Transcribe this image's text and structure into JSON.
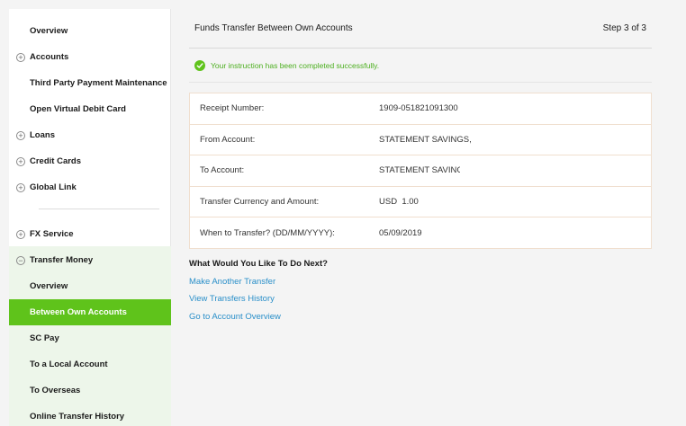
{
  "sidebar": {
    "items": [
      {
        "label": "Overview",
        "expandable": false
      },
      {
        "label": "Accounts",
        "expandable": true
      },
      {
        "label": "Third Party Payment Maintenance",
        "expandable": false
      },
      {
        "label": "Open Virtual Debit Card",
        "expandable": false
      },
      {
        "label": "Loans",
        "expandable": true
      },
      {
        "label": "Credit Cards",
        "expandable": true
      },
      {
        "label": "Global Link",
        "expandable": true
      },
      {
        "label": "FX Service",
        "expandable": true
      },
      {
        "label": "Transfer Money",
        "expandable": true,
        "expanded": true
      },
      {
        "label": "Overview",
        "sub": true
      },
      {
        "label": "Between Own Accounts",
        "sub": true,
        "active": true
      },
      {
        "label": "SC Pay",
        "sub": true
      },
      {
        "label": "To a Local Account",
        "sub": true
      },
      {
        "label": "To Overseas",
        "sub": true
      },
      {
        "label": "Online Transfer History",
        "sub": true
      }
    ],
    "expand_glyph": "+",
    "collapse_glyph": "−"
  },
  "main": {
    "title": "Funds Transfer Between Own Accounts",
    "step": "Step 3 of 3",
    "success_message": "Your instruction has been completed successfully.",
    "details": [
      {
        "label": "Receipt Number:",
        "value": "1909-051821091300"
      },
      {
        "label": "From Account:",
        "value": "STATEMENT SAVINGS,"
      },
      {
        "label": "To Account:",
        "value": "STATEMENT SAVINGS,"
      },
      {
        "label": "Transfer Currency and Amount:",
        "value": "USD  1.00"
      },
      {
        "label": "When to Transfer? (DD/MM/YYYY):",
        "value": "05/09/2019"
      }
    ],
    "next_title": "What Would You Like To Do Next?",
    "links": [
      "Make Another Transfer",
      "View Transfers History",
      "Go to Account Overview"
    ]
  },
  "colors": {
    "accent_green": "#5fc31b",
    "success_text": "#4caf1f",
    "link_blue": "#2a8fc9",
    "active_section_bg": "#edf6ea"
  }
}
